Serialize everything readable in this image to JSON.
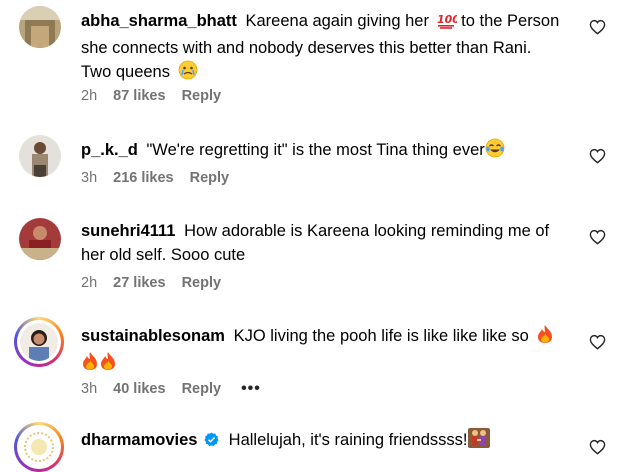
{
  "comments": [
    {
      "username": "abha_sharma_bhatt",
      "text_before": "Kareena again giving her",
      "text_after": "to the Person she connects with and nobody deserves this better than Rani. Two queens",
      "time": "2h",
      "likes": "87 likes",
      "reply": "Reply",
      "emojis": [
        "hundred-points",
        "crying-face"
      ]
    },
    {
      "username": "p_.k._d",
      "text": "\"We're regretting it\" is the most Tina thing ever",
      "time": "3h",
      "likes": "216 likes",
      "reply": "Reply",
      "emojis": [
        "tears-of-joy"
      ]
    },
    {
      "username": "sunehri4111",
      "text": "How adorable is Kareena looking reminding me of her old self. Sooo cute",
      "time": "2h",
      "likes": "27 likes",
      "reply": "Reply"
    },
    {
      "username": "sustainablesonam",
      "text": "KJO living the pooh life is like like like so",
      "time": "3h",
      "likes": "40 likes",
      "reply": "Reply",
      "more": "•••",
      "emojis": [
        "fire",
        "fire",
        "fire"
      ]
    },
    {
      "username": "dharmamovies",
      "verified": true,
      "text": "Hallelujah, it's raining friendssss!",
      "emojis": [
        "women-holding-hands"
      ]
    }
  ],
  "colors": {
    "text": "#000000",
    "meta": "#737373",
    "verified": "#0095f6"
  },
  "icons": {
    "like": "heart-outline-icon",
    "verified": "verified-badge-icon",
    "more": "more-options-icon"
  }
}
